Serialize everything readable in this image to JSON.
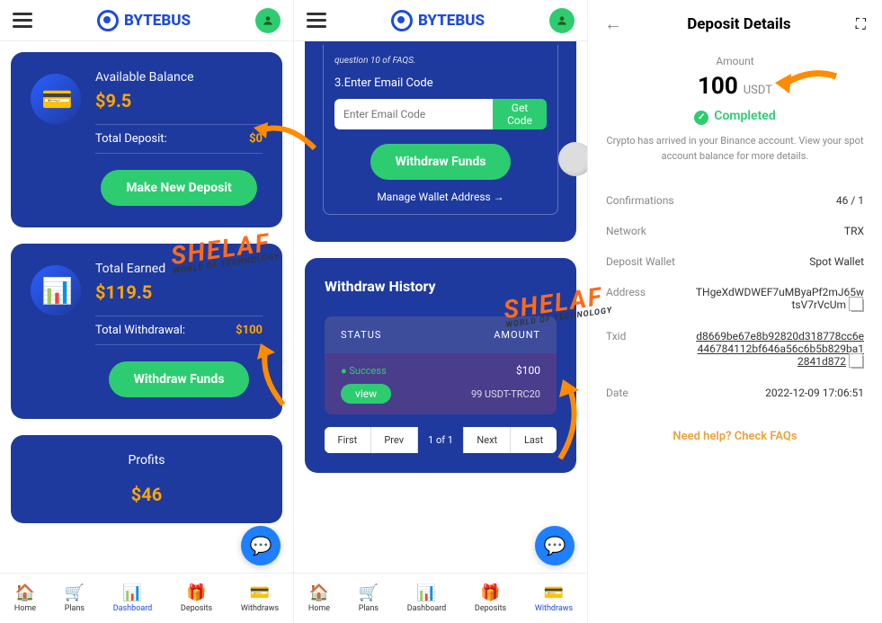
{
  "brand": "BYTEBUS",
  "panel1": {
    "balance_label": "Available Balance",
    "balance_value": "$9.5",
    "total_deposit_label": "Total Deposit:",
    "total_deposit_value": "$0",
    "make_deposit_btn": "Make New Deposit",
    "earned_label": "Total Earned",
    "earned_value": "$119.5",
    "withdrawal_label": "Total Withdrawal:",
    "withdrawal_value": "$100",
    "withdraw_btn": "Withdraw Funds",
    "profits_label": "Profits",
    "profits_value": "$46"
  },
  "panel2": {
    "faq_note": "question 10 of FAQS.",
    "step3": "3.Enter Email Code",
    "email_placeholder": "Enter Email Code",
    "get_code_btn": "Get Code",
    "withdraw_btn": "Withdraw Funds",
    "manage_wallet": "Manage Wallet Address →",
    "history_title": "Withdraw History",
    "th_status": "STATUS",
    "th_amount": "AMOUNT",
    "row_status": "● Success",
    "row_amount": "$100",
    "view_btn": "view",
    "row_detail": "99 USDT-TRC20",
    "pager": {
      "first": "First",
      "prev": "Prev",
      "current": "1 of 1",
      "next": "Next",
      "last": "Last"
    }
  },
  "panel3": {
    "title": "Deposit Details",
    "amount_label": "Amount",
    "amount_value": "100",
    "amount_currency": "USDT",
    "status": "Completed",
    "note": "Crypto has arrived in your Binance account. View your spot account balance for more details.",
    "rows": {
      "confirmations_k": "Confirmations",
      "confirmations_v": "46 / 1",
      "network_k": "Network",
      "network_v": "TRX",
      "wallet_k": "Deposit Wallet",
      "wallet_v": "Spot Wallet",
      "address_k": "Address",
      "address_v": "THgeXdWDWEF7uMByaPf2mJ65wtsV7rVcUm",
      "txid_k": "Txid",
      "txid_v": "d8669be67e8b92820d318778cc6e446784112bf646a56c6b5b829ba12841d872",
      "date_k": "Date",
      "date_v": "2022-12-09 17:06:51"
    },
    "help": "Need help? Check FAQs"
  },
  "nav": {
    "home": "Home",
    "plans": "Plans",
    "dashboard": "Dashboard",
    "deposits": "Deposits",
    "withdraws": "Withdraws"
  }
}
